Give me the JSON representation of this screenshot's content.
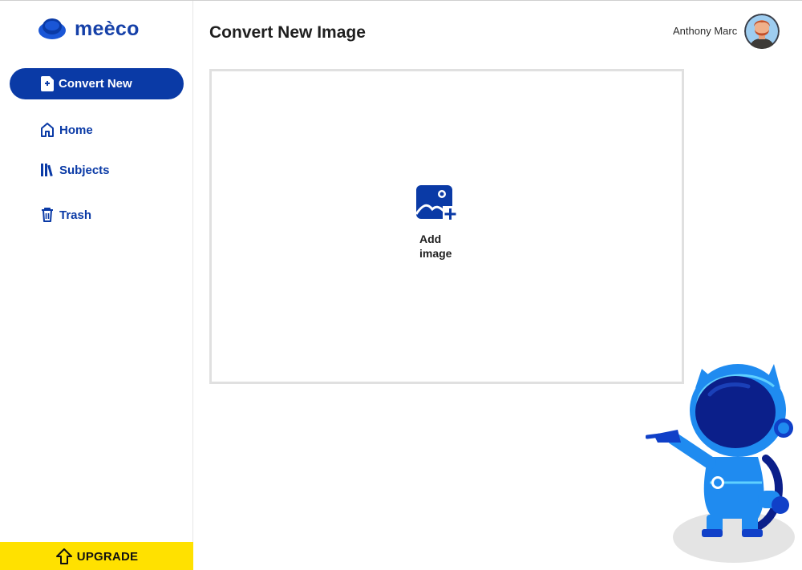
{
  "app": {
    "logo_text": "meèco"
  },
  "sidebar": {
    "convert_button": {
      "label": "Convert New",
      "icon": "file-plus-icon"
    },
    "items": [
      {
        "label": "Home",
        "icon": "home-icon"
      },
      {
        "label": "Subjects",
        "icon": "books-icon"
      },
      {
        "label": "Trash",
        "icon": "trash-icon"
      }
    ],
    "upgrade": {
      "label": "UPGRADE",
      "icon": "arrow-up-outline-icon"
    }
  },
  "header": {
    "title": "Convert New Image",
    "user_name": "Anthony Marc"
  },
  "dropzone": {
    "label": "Add image",
    "icon": "image-add-icon"
  },
  "colors": {
    "brand_blue": "#0a3aa6",
    "upgrade_yellow": "#ffe100",
    "border_gray": "#e0e0e0"
  }
}
